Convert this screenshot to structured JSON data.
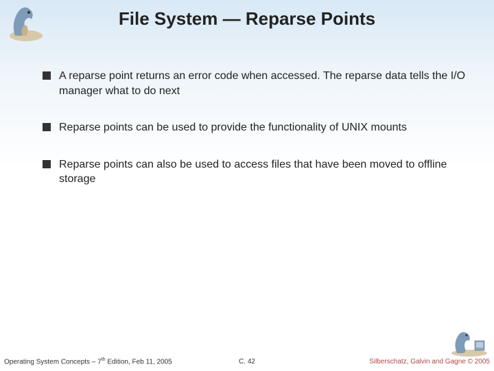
{
  "title": "File System — Reparse Points",
  "bullets": [
    "A reparse point returns an error code when accessed. The reparse data tells the I/O manager what to do next",
    "Reparse points can be used to provide the functionality of UNIX mounts",
    "Reparse points can also be used to access files that have been moved to offline storage"
  ],
  "footer": {
    "left_pre": "Operating System Concepts – 7",
    "left_sup": "th",
    "left_post": " Edition, Feb 11, 2005",
    "center": "C. 42",
    "right": "Silberschatz, Galvin and Gagne © 2005"
  },
  "icons": {
    "dino_tl": "dinosaur-logo",
    "dino_br": "dinosaur-logo-small"
  }
}
